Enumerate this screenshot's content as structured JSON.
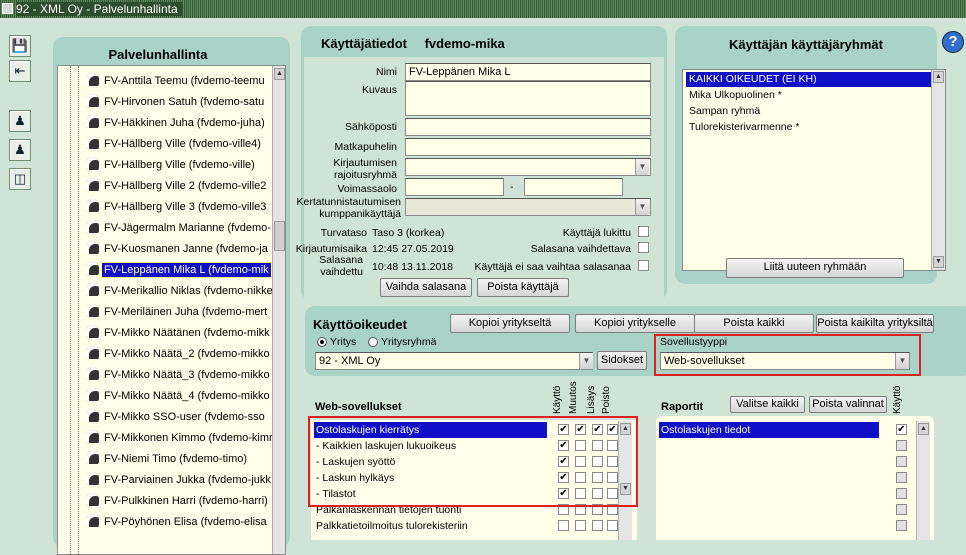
{
  "window": {
    "title": "92 - XML Oy - Palvelunhallinta"
  },
  "toolbar": {
    "icons": [
      "save-icon",
      "exit-icon",
      "user-add-icon",
      "user-copy-icon",
      "import-icon"
    ]
  },
  "left_panel": {
    "title": "Palvelunhallinta",
    "users": [
      "FV-Anttila Teemu (fvdemo-teemu",
      "FV-Hirvonen Satuh (fvdemo-satu",
      "FV-Häkkinen Juha (fvdemo-juha)",
      "FV-Hällberg Ville (fvdemo-ville4)",
      "FV-Hällberg Ville (fvdemo-ville)",
      "FV-Hällberg Ville 2 (fvdemo-ville2",
      "FV-Hällberg Ville 3 (fvdemo-ville3",
      "FV-Jägermalm Marianne (fvdemo-",
      "FV-Kuosmanen Janne (fvdemo-ja",
      "FV-Leppänen Mika L (fvdemo-mik",
      "FV-Merikallio Niklas (fvdemo-nikke",
      "FV-Meriläinen Juha (fvdemo-mert",
      "FV-Mikko Näätänen (fvdemo-mikk",
      "FV-Mikko Näätä_2 (fvdemo-mikko",
      "FV-Mikko Näätä_3 (fvdemo-mikko",
      "FV-Mikko Näätä_4 (fvdemo-mikko",
      "FV-Mikko SSO-user (fvdemo-sso",
      "FV-Mikkonen Kimmo (fvdemo-kimr",
      "FV-Niemi Timo (fvdemo-timo)",
      "FV-Parviainen Jukka (fvdemo-jukk",
      "FV-Pulkkinen Harri (fvdemo-harri)",
      "FV-Pöyhönen Elisa (fvdemo-elisa"
    ],
    "selected_index": 9
  },
  "user_info": {
    "title": "Käyttäjätiedot",
    "username": "fvdemo-mika",
    "labels": {
      "name": "Nimi",
      "description": "Kuvaus",
      "email": "Sähköposti",
      "mobile": "Matkapuhelin",
      "login_group": "Kirjautumisen rajoitusryhmä",
      "valid": "Voimassaolo",
      "partner": "Kertatunnistautumisen kumppanikäyttäjä",
      "security": "Turvataso",
      "login_time": "Kirjautumisaika",
      "pw_changed": "Salasana vaihdettu",
      "locked": "Käyttäjä lukittu",
      "pw_must_change": "Salasana vaihdettava",
      "pw_no_change": "Käyttäjä ei saa vaihtaa salasanaa"
    },
    "values": {
      "name": "FV-Leppänen Mika L",
      "description": "",
      "email": "",
      "mobile": "",
      "valid_sep": "-",
      "security": "Taso 3 (korkea)",
      "login_time": "12:45 27.05.2019",
      "pw_changed": "10:48 13.11.2018"
    },
    "buttons": {
      "change_pw": "Vaihda salasana",
      "delete_user": "Poista käyttäjä"
    }
  },
  "groups": {
    "title": "Käyttäjän käyttäjäryhmät",
    "items": [
      "KAIKKI OIKEUDET (EI KH)",
      "Mika Ulkopuolinen *",
      "Sampan ryhmä",
      "Tulorekisterivarmenne *"
    ],
    "selected_index": 0,
    "button": "Liitä uuteen ryhmään"
  },
  "rights": {
    "title": "Käyttöoikeudet",
    "buttons": {
      "copy_from": "Kopioi yritykseltä",
      "copy_to": "Kopioi yritykselle",
      "remove_all": "Poista kaikki",
      "remove_all_companies": "Poista kaikilta yrityksiltä",
      "links": "Sidokset"
    },
    "radio": {
      "company": "Yritys",
      "company_group": "Yritysryhmä",
      "selected": "company"
    },
    "company_select": "92 - XML Oy",
    "app_type_label": "Sovellustyyppi",
    "app_type_value": "Web-sovellukset"
  },
  "web_apps": {
    "title": "Web-sovellukset",
    "columns": [
      "Käyttö",
      "Muutos",
      "Lisäys",
      "Poisto"
    ],
    "rows": [
      {
        "name": "Ostolaskujen kierrätys",
        "checks": [
          true,
          true,
          true,
          true
        ]
      },
      {
        "name": "- Kaikkien laskujen lukuoikeus",
        "checks": [
          true,
          false,
          false,
          false
        ]
      },
      {
        "name": "- Laskujen syöttö",
        "checks": [
          true,
          false,
          false,
          false
        ]
      },
      {
        "name": "- Laskun hylkäys",
        "checks": [
          true,
          false,
          false,
          false
        ]
      },
      {
        "name": "- Tilastot",
        "checks": [
          true,
          false,
          false,
          false
        ]
      },
      {
        "name": "Palkanlaskennan tietojen tuonti",
        "checks": [
          false,
          false,
          false,
          false
        ]
      },
      {
        "name": "Palkkatietoilmoitus tulorekisteriin",
        "checks": [
          false,
          false,
          false,
          false
        ]
      }
    ],
    "selected_index": 0
  },
  "reports": {
    "title": "Raportit",
    "select_all": "Valitse kaikki",
    "remove_selected": "Poista valinnat",
    "column": "Käyttö",
    "rows": [
      {
        "name": "Ostolaskujen tiedot",
        "checked": true
      }
    ],
    "extra_checks": [
      false,
      false,
      false,
      false,
      false,
      false
    ]
  },
  "colors": {
    "background": "#cfe3d6",
    "panel": "#a8d3c6",
    "selection": "#1010c8",
    "highlight": "#e02020",
    "field": "#fffee8"
  }
}
